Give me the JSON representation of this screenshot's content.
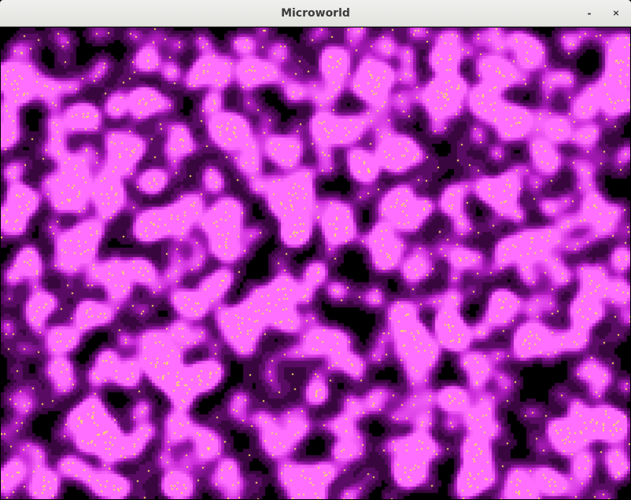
{
  "window": {
    "title": "Microworld",
    "minimize_glyph": "-",
    "close_glyph": "×"
  },
  "simulation": {
    "colors": {
      "background": "#000000",
      "halo_dark": "#3a0840",
      "halo_mid": "#6a0f78",
      "halo_bright": "#c020d0",
      "core": "#ff40ff",
      "particle": "#ffe060"
    }
  }
}
